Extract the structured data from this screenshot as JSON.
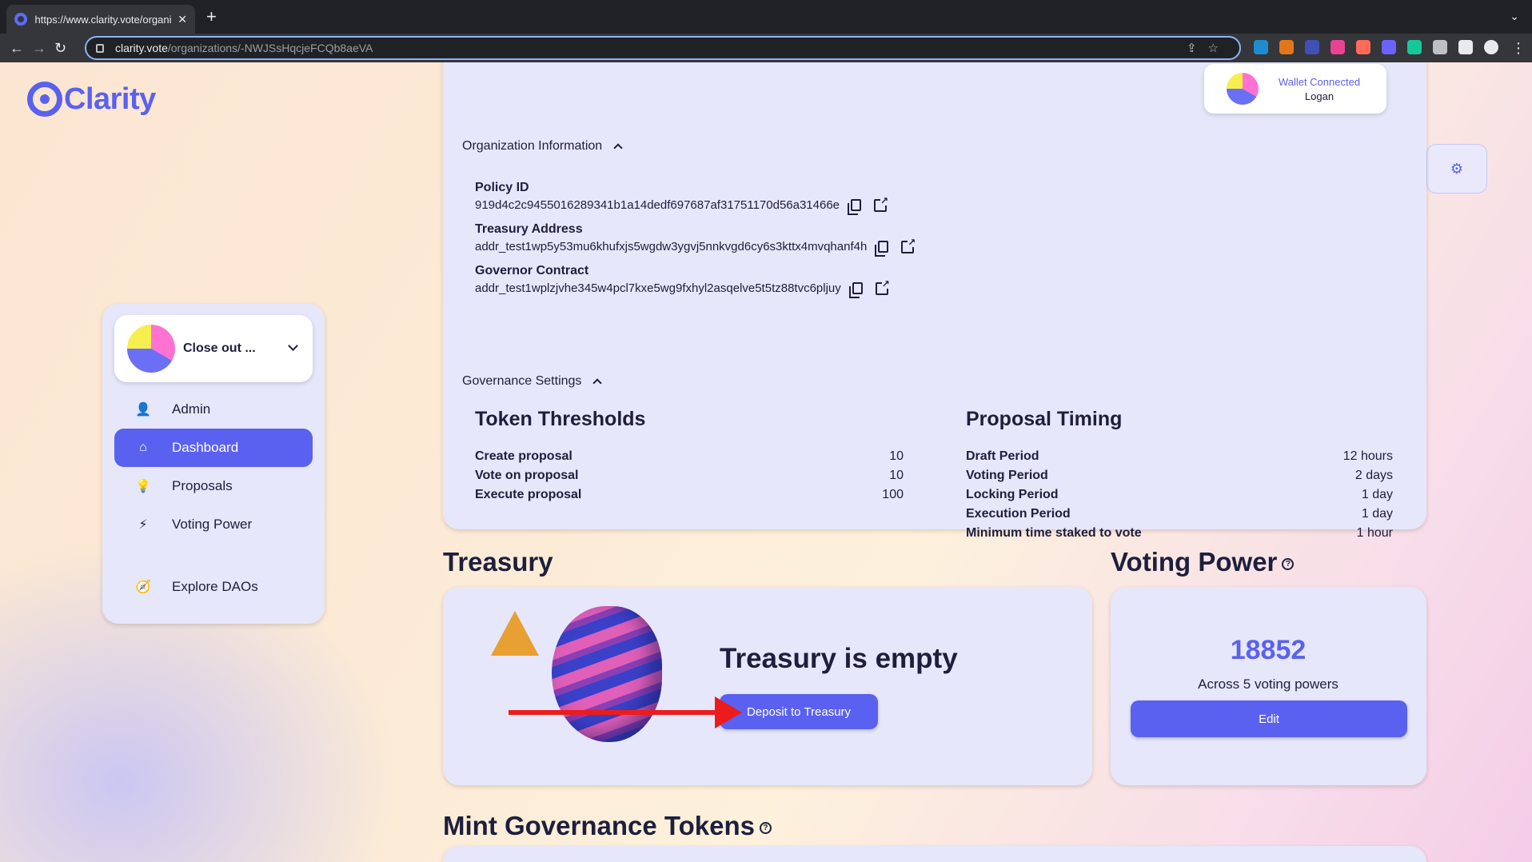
{
  "browser": {
    "tab_title": "https://www.clarity.vote/organi",
    "tab_close": "✕",
    "new_tab": "+",
    "url_host": "clarity.vote",
    "url_path": "/organizations/-NWJSsHqcjeFCQb8aeVA"
  },
  "logo": {
    "text": "Clarity"
  },
  "sidebar": {
    "org_name": "Close out ...",
    "items": [
      {
        "label": "Admin",
        "icon": "👤"
      },
      {
        "label": "Dashboard",
        "icon": "⌂"
      },
      {
        "label": "Proposals",
        "icon": "💡"
      },
      {
        "label": "Voting Power",
        "icon": "⚡"
      },
      {
        "label": "Explore DAOs",
        "icon": "🧭"
      }
    ]
  },
  "wallet": {
    "status": "Wallet Connected",
    "user": "Logan"
  },
  "org_info": {
    "heading": "Organization Information",
    "policy_id_label": "Policy ID",
    "policy_id": "919d4c2c9455016289341b1a14dedf697687af31751170d56a31466e",
    "treasury_label": "Treasury Address",
    "treasury_address": "addr_test1wp5y53mu6khufxjs5wgdw3ygvj5nnkvgd6cy6s3kttx4mvqhanf4h",
    "governor_label": "Governor Contract",
    "governor_contract": "addr_test1wplzjvhe345w4pcl7kxe5wg9fxhyl2asqelve5t5tz88tvc6pljuy"
  },
  "governance": {
    "heading": "Governance Settings",
    "thresholds_title": "Token Thresholds",
    "thresholds": [
      {
        "label": "Create proposal",
        "value": "10"
      },
      {
        "label": "Vote on proposal",
        "value": "10"
      },
      {
        "label": "Execute proposal",
        "value": "100"
      }
    ],
    "timing_title": "Proposal Timing",
    "timing": [
      {
        "label": "Draft Period",
        "value": "12 hours"
      },
      {
        "label": "Voting Period",
        "value": "2 days"
      },
      {
        "label": "Locking Period",
        "value": "1 day"
      },
      {
        "label": "Execution Period",
        "value": "1 day"
      },
      {
        "label": "Minimum time staked to vote",
        "value": "1 hour"
      }
    ]
  },
  "treasury": {
    "heading": "Treasury",
    "empty_text": "Treasury is empty",
    "deposit_label": "Deposit to Treasury"
  },
  "voting_power": {
    "heading": "Voting Power",
    "amount": "18852",
    "caption": "Across 5 voting powers",
    "edit_label": "Edit"
  },
  "mint": {
    "heading": "Mint Governance Tokens"
  },
  "help_glyph": "?",
  "colors": {
    "accent": "#5a61f0",
    "text": "#1d1f3d",
    "card": "#e6e7fa",
    "annotation_arrow": "#ec1c1c"
  }
}
